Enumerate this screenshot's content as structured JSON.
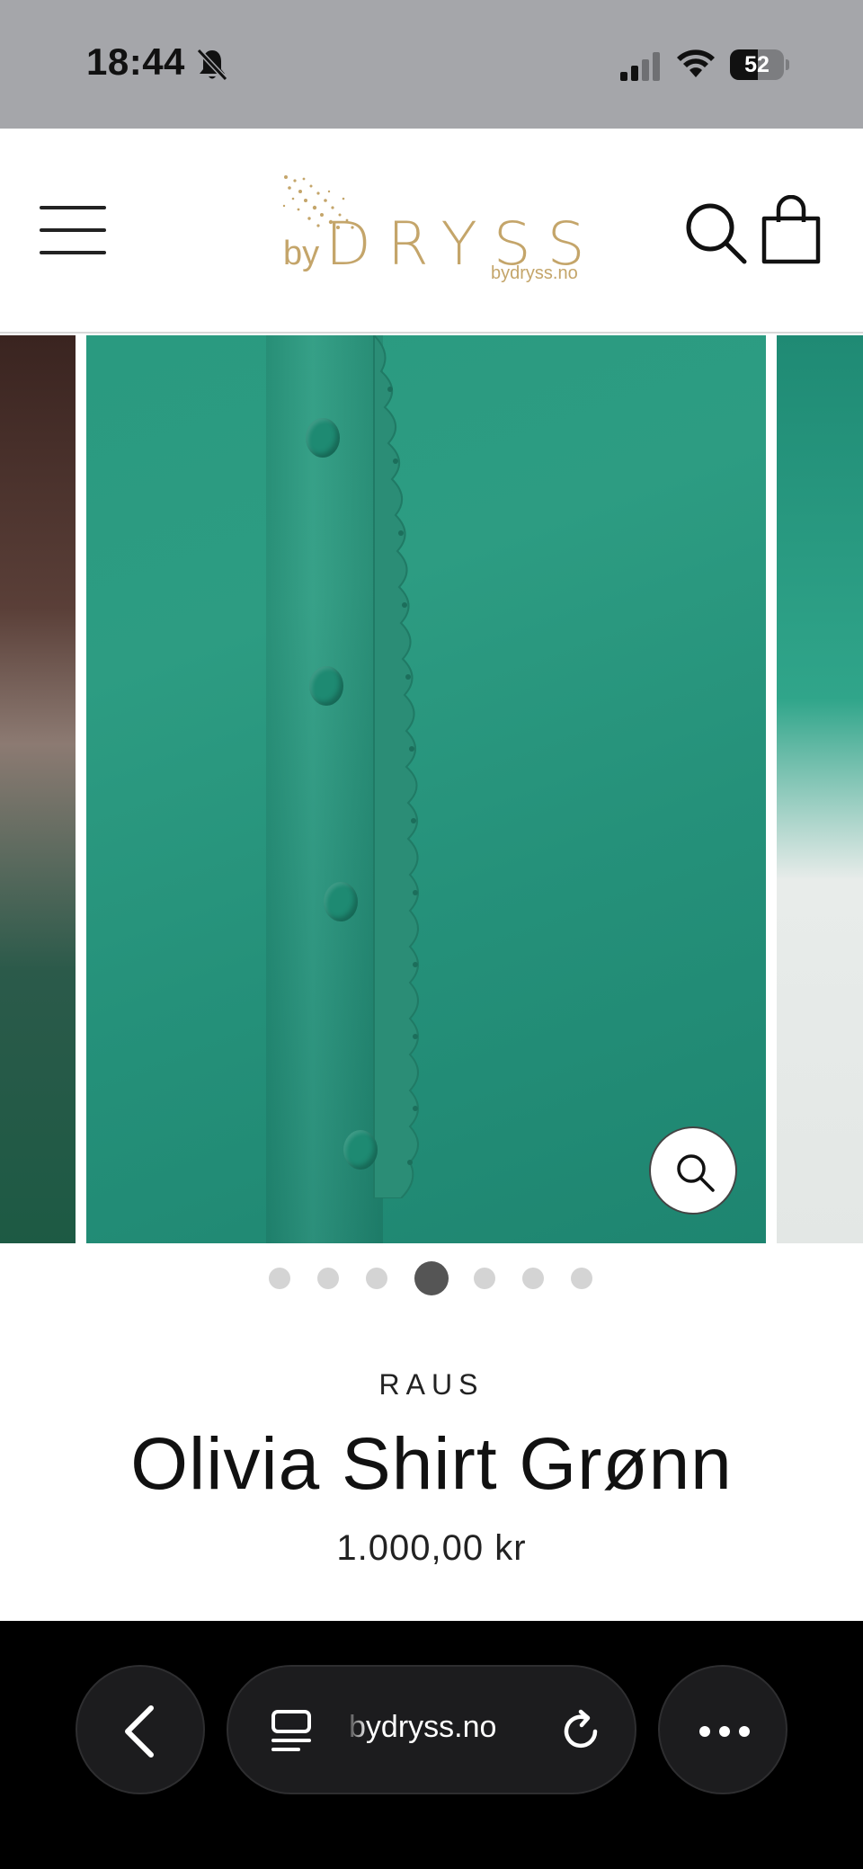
{
  "status_bar": {
    "time": "18:44",
    "battery_level": "52",
    "battery_fraction": 0.52
  },
  "header": {
    "menu_icon": "hamburger-menu-icon",
    "logo": {
      "prefix": "by",
      "name": "DRYSS",
      "url": "bydryss.no"
    },
    "search_icon": "search-icon",
    "cart_icon": "shopping-bag-icon"
  },
  "gallery": {
    "slide_count": 7,
    "active_index": 3,
    "zoom_icon": "magnifier-icon"
  },
  "product": {
    "vendor": "RAUS",
    "title": "Olivia Shirt Grønn",
    "price": "1.000,00 kr"
  },
  "browser": {
    "url": "bydryss.no",
    "back_icon": "chevron-left-icon",
    "tabs_icon": "tab-overview-icon",
    "reload_icon": "reload-icon",
    "more_icon": "more-dots-icon"
  },
  "colors": {
    "brand_gold": "#c4a56a",
    "shirt_green": "#2a9a80",
    "status_bar_bg": "#a5a6aa"
  }
}
